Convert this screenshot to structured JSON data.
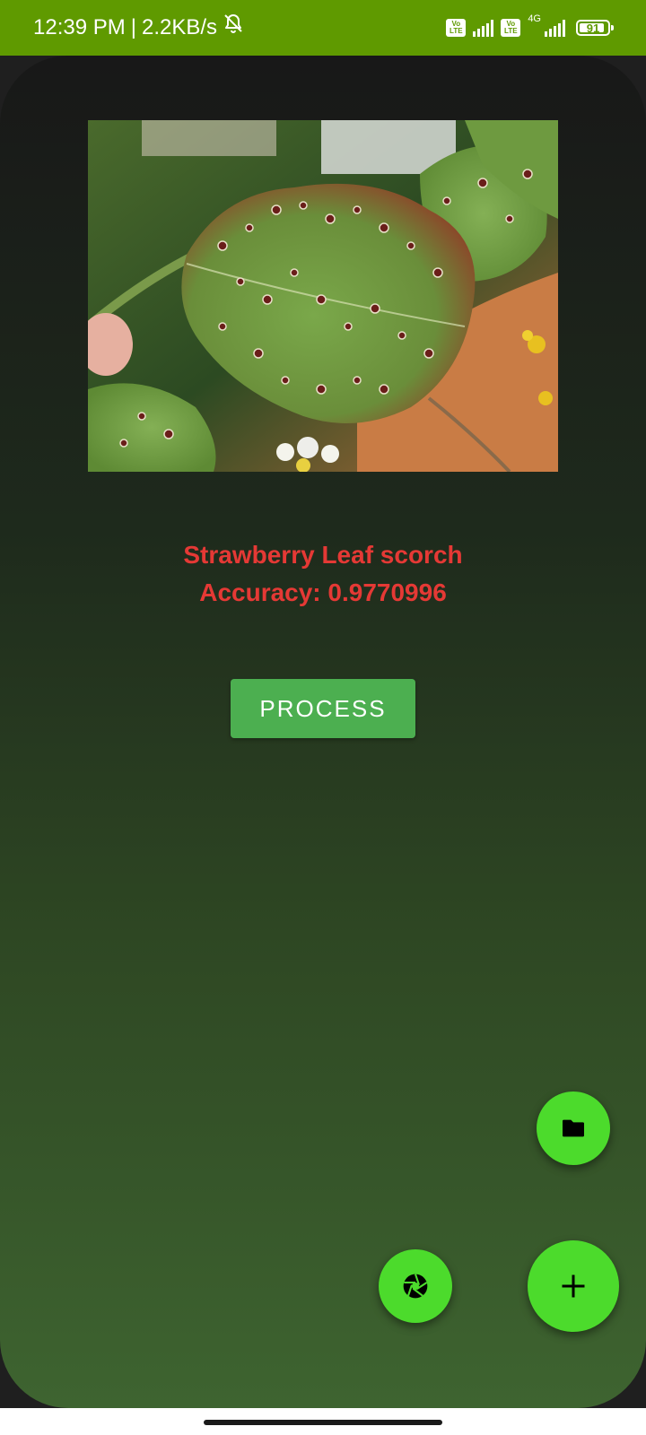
{
  "status_bar": {
    "time": "12:39 PM",
    "separator": "|",
    "net_speed": "2.2KB/s",
    "volte_top": "Vo",
    "volte_bottom": "LTE",
    "network_type": "4G",
    "battery_level": "91",
    "battery_fraction": 0.91,
    "background_color": "#5f9a00"
  },
  "result": {
    "label": "Strawberry Leaf scorch",
    "accuracy": "Accuracy: 0.9770996",
    "color": "#e53935"
  },
  "process_button": {
    "label": "PROCESS",
    "color": "#4caf50"
  },
  "fabs": {
    "folder_icon": "folder-icon",
    "camera_icon": "camera-shutter-icon",
    "add_icon": "plus-icon",
    "color": "#4cdb2c"
  },
  "image": {
    "icon": "strawberry-leaf-photo"
  }
}
